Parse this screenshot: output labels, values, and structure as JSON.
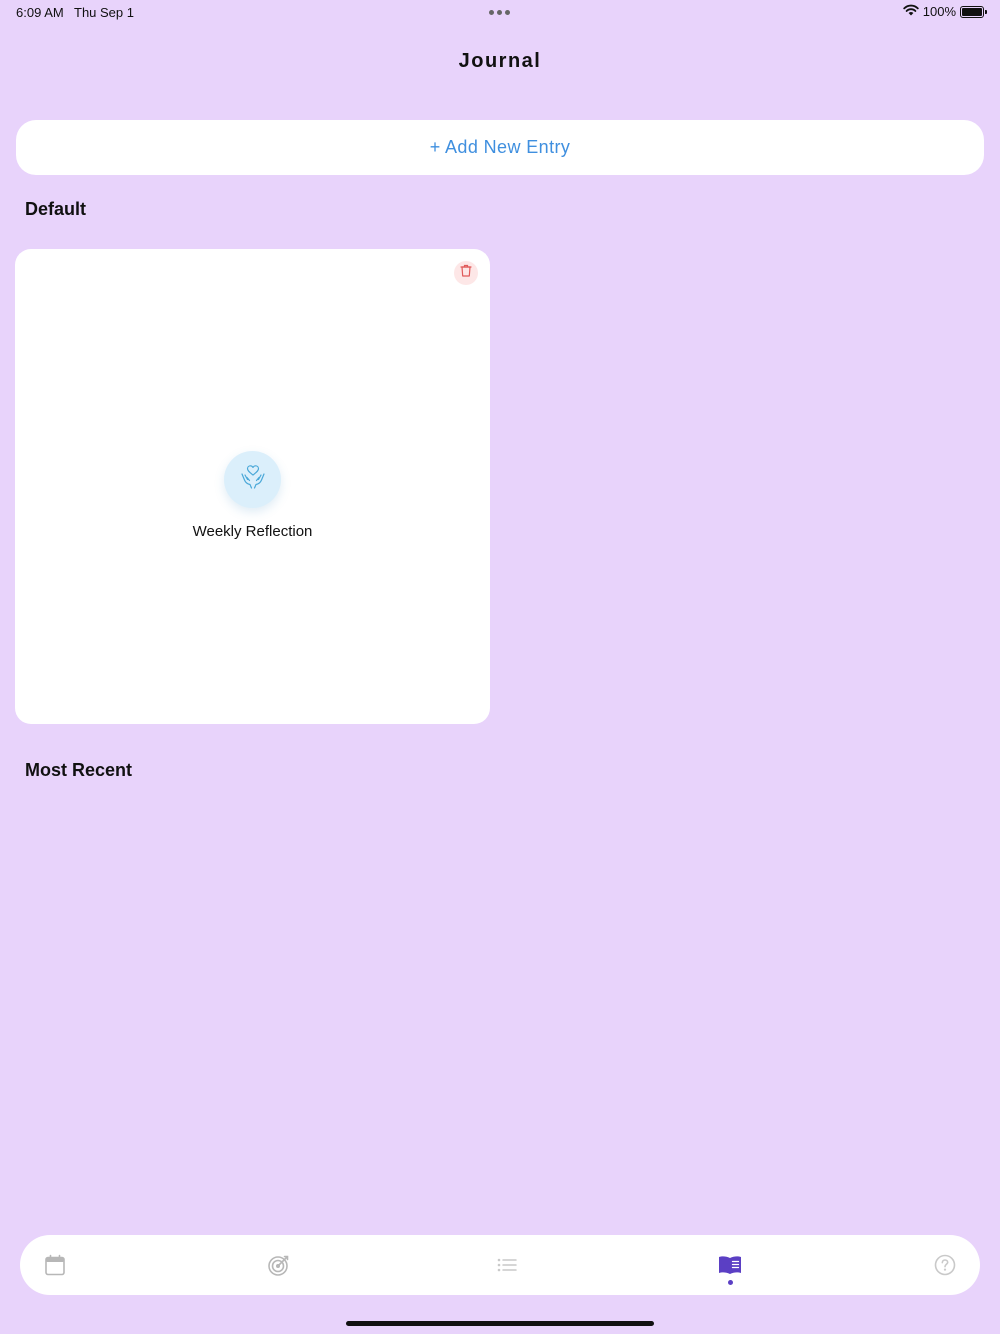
{
  "status_bar": {
    "time": "6:09 AM",
    "date": "Thu Sep 1",
    "battery_percent": "100%",
    "wifi_icon": "wifi-icon",
    "battery_icon": "battery-icon"
  },
  "header": {
    "title": "Journal"
  },
  "add_entry": {
    "label": "+ Add New Entry"
  },
  "sections": {
    "default_title": "Default",
    "recent_title": "Most Recent"
  },
  "default_entries": [
    {
      "label": "Weekly Reflection",
      "icon": "heart-hands-icon",
      "delete_icon": "trash-icon"
    }
  ],
  "tab_bar": {
    "tabs": [
      {
        "icon": "calendar-icon",
        "active": false
      },
      {
        "icon": "target-icon",
        "active": false
      },
      {
        "icon": "list-icon",
        "active": false
      },
      {
        "icon": "journal-book-icon",
        "active": true
      },
      {
        "icon": "help-icon",
        "active": false
      }
    ]
  },
  "colors": {
    "background": "#e8d3fb",
    "accent_blue": "#3f8fdf",
    "active_tab": "#5b3fc4",
    "delete_red": "#e05a5a",
    "icon_circle": "#dbeffb"
  }
}
